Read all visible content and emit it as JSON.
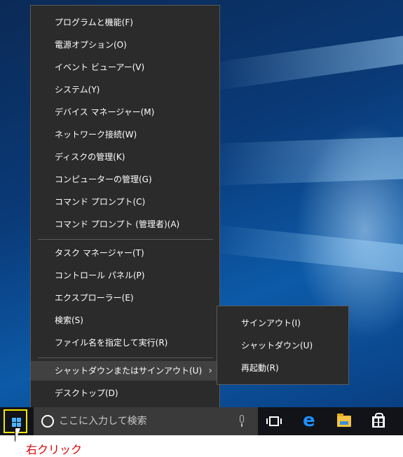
{
  "context_menu": {
    "items": [
      {
        "label": "プログラムと機能(F)"
      },
      {
        "label": "電源オプション(O)"
      },
      {
        "label": "イベント ビューアー(V)"
      },
      {
        "label": "システム(Y)"
      },
      {
        "label": "デバイス マネージャー(M)"
      },
      {
        "label": "ネットワーク接続(W)"
      },
      {
        "label": "ディスクの管理(K)"
      },
      {
        "label": "コンピューターの管理(G)"
      },
      {
        "label": "コマンド プロンプト(C)"
      },
      {
        "label": "コマンド プロンプト (管理者)(A)"
      },
      {
        "label": "タスク マネージャー(T)"
      },
      {
        "label": "コントロール パネル(P)"
      },
      {
        "label": "エクスプローラー(E)"
      },
      {
        "label": "検索(S)"
      },
      {
        "label": "ファイル名を指定して実行(R)"
      },
      {
        "label": "シャットダウンまたはサインアウト(U)",
        "highlighted": true,
        "has_submenu": true
      },
      {
        "label": "デスクトップ(D)"
      }
    ]
  },
  "submenu": {
    "items": [
      {
        "label": "サインアウト(I)"
      },
      {
        "label": "シャットダウン(U)"
      },
      {
        "label": "再起動(R)"
      }
    ]
  },
  "taskbar": {
    "search_placeholder": "ここに入力して検索",
    "icons": [
      "start-icon",
      "cortana-icon",
      "microphone-icon",
      "task-view-icon",
      "edge-icon",
      "file-explorer-icon",
      "store-icon"
    ]
  },
  "annotation": {
    "text": "右クリック",
    "color": "#e00000"
  },
  "colors": {
    "menu_bg": "#2b2b2b",
    "menu_highlight": "#414141",
    "taskbar_bg": "#111319",
    "start_highlight_border": "#f2e600"
  }
}
